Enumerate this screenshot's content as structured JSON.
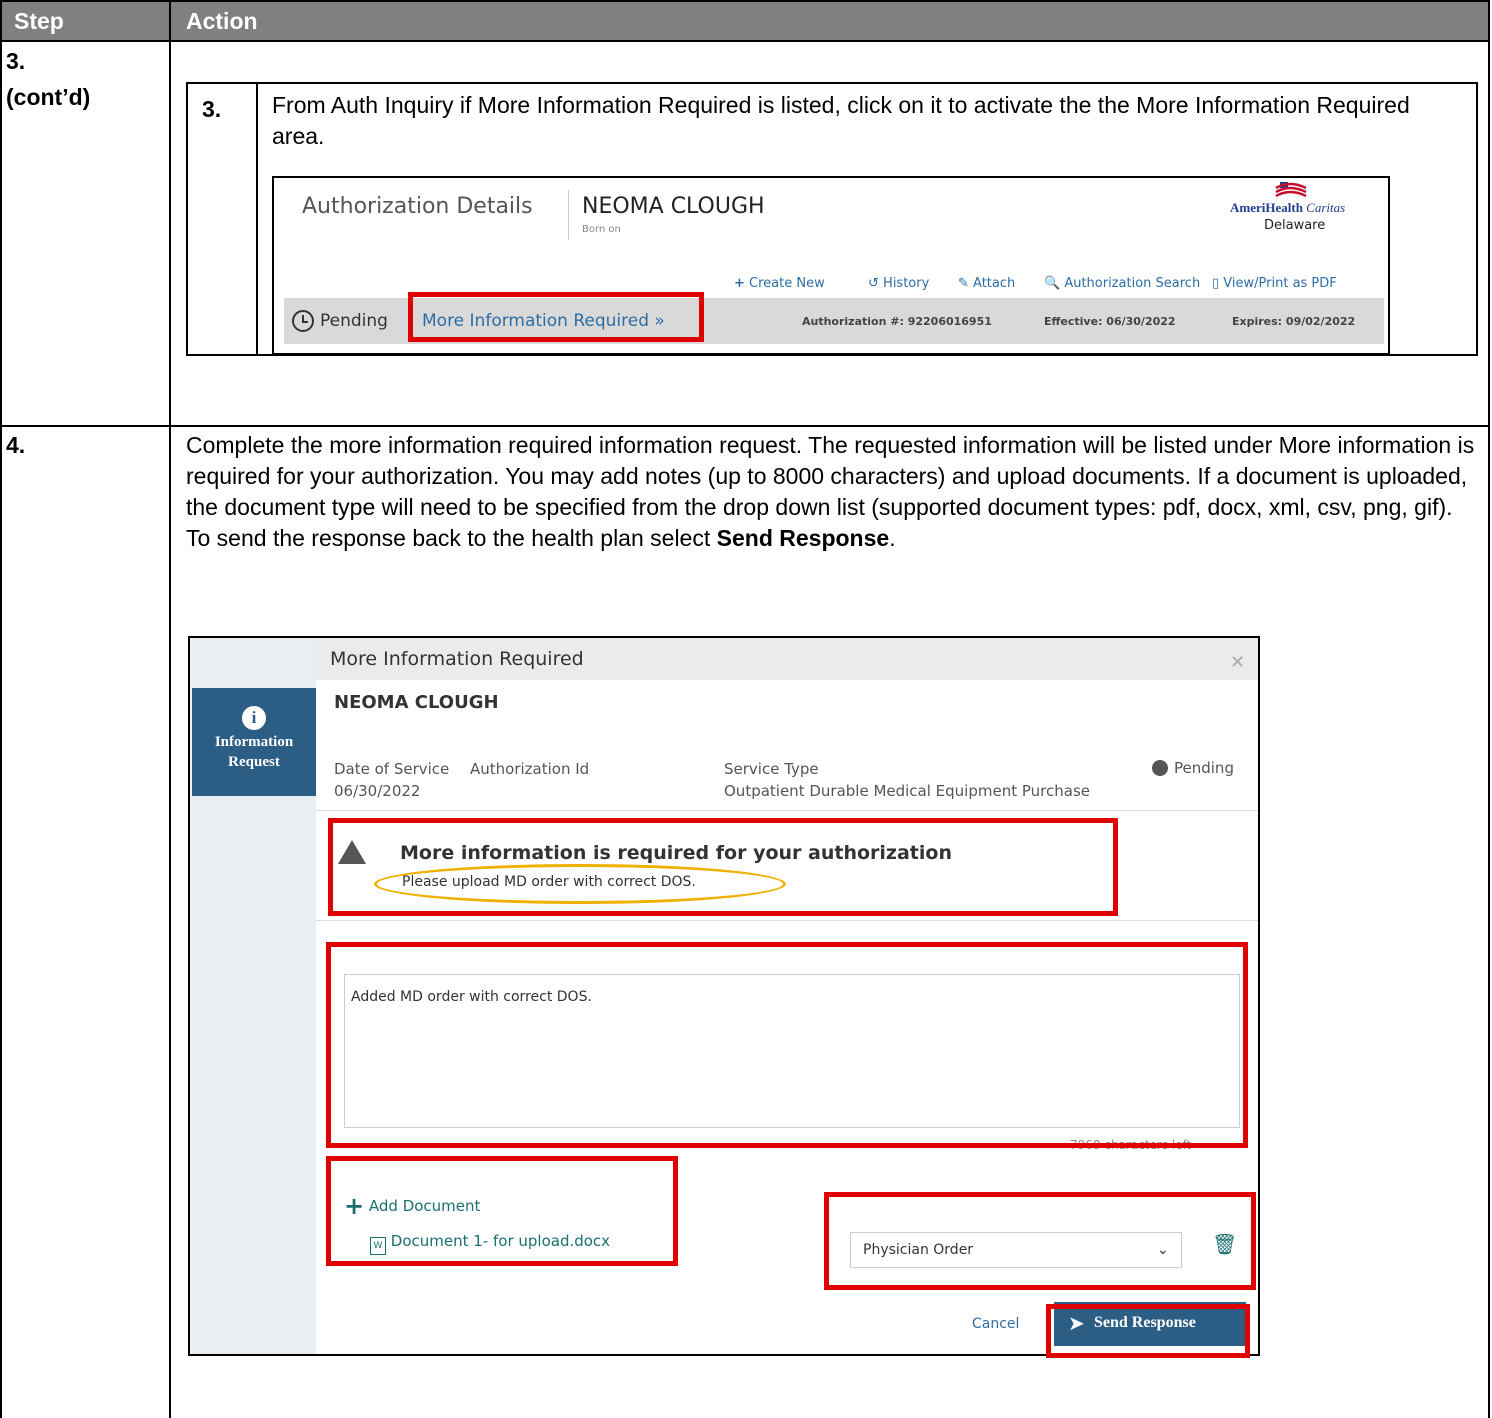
{
  "header": {
    "col1": "Step",
    "col2": "Action"
  },
  "step3": {
    "label_line1": "3.",
    "label_line2": "(cont’d)",
    "substep_num": "3.",
    "instruction": "From Auth Inquiry if More Information Required is listed, click on it to activate the the More Information Required area.",
    "auth_screen": {
      "title": "Authorization Details",
      "patient_name": "NEOMA CLOUGH",
      "born_on": "Born on",
      "logo_brand": "AmeriHealth",
      "logo_brand2": "Caritas",
      "logo_state": "Delaware",
      "links": [
        "Create New",
        "History",
        "Attach",
        "Authorization Search",
        "View/Print as PDF"
      ],
      "status": "Pending",
      "more_info_link": "More Information Required »",
      "auth_number": "Authorization #: 92206016951",
      "effective": "Effective: 06/30/2022",
      "expires": "Expires: 09/02/2022"
    }
  },
  "step4": {
    "label": "4.",
    "text_before": "Complete the more information required information request. The requested information will be listed under More information is required for your authorization. You may add notes (up to 8000 characters) and upload documents. If a document is uploaded, the document type will need to be specified from the drop down list (supported document types: pdf, docx, xml, csv, png, gif). To send the response back to the health plan select ",
    "text_bold": "Send Response",
    "text_after": ".",
    "modal": {
      "title": "More Information Required",
      "side_label_1": "Information",
      "side_label_2": "Request",
      "patient_name": "NEOMA CLOUGH",
      "dos_label": "Date of Service",
      "auth_id_label": "Authorization Id",
      "dos_value": "06/30/2022",
      "service_type_label": "Service Type",
      "service_type_value": "Outpatient Durable Medical Equipment Purchase",
      "status": "Pending",
      "alert_title": "More information is required for your authorization",
      "alert_message": "Please upload MD order with correct DOS.",
      "notes_value": "Added MD order with correct DOS.",
      "chars_left": "7968 characters left",
      "add_document": "Add Document",
      "document_name": "Document 1- for upload.docx",
      "doc_type_selected": "Physician Order",
      "cancel": "Cancel",
      "send": "Send Response"
    }
  }
}
